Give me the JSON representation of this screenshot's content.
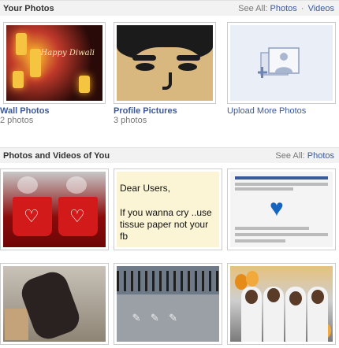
{
  "your_photos": {
    "title": "Your Photos",
    "see_all": "See All:",
    "photos_link": "Photos",
    "separator": "·",
    "videos_link": "Videos",
    "albums": [
      {
        "name": "Wall Photos",
        "count": "2 photos"
      },
      {
        "name": "Profile Pictures",
        "count": "3 photos"
      }
    ],
    "upload_label": "Upload More Photos"
  },
  "photos_of_you": {
    "title": "Photos and Videos of You",
    "see_all": "See All:",
    "photos_link": "Photos"
  },
  "photo_texts": {
    "diwali": "Happy Diwali",
    "note_line1": "Dear Users,",
    "note_line2": "If you wanna cry ..use tissue paper not your fb"
  },
  "colors": {
    "link": "#3b5998",
    "header_bg": "#f2f2f2"
  }
}
